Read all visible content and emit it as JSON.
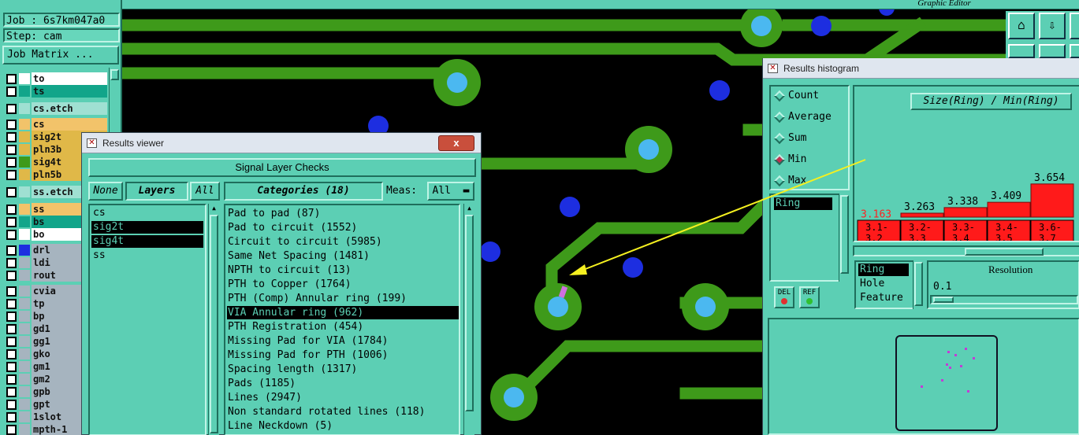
{
  "left_panel": {
    "job_line": "Job : 6s7km047a0",
    "step_line": "Step: cam",
    "job_matrix_label": "Job Matrix ...",
    "layers": [
      {
        "name": "to",
        "color": "#ffffff",
        "board": true
      },
      {
        "name": "ts",
        "color": "#12a58a",
        "board": false
      },
      {
        "name": "cs.etch",
        "color": "#9fe0d2",
        "board": false
      },
      {
        "name": "cs",
        "color": "#f2c36a",
        "board": true
      },
      {
        "name": "sig2t",
        "color": "#e0b848",
        "board": false
      },
      {
        "name": "pln3b",
        "color": "#e0b848",
        "board": false
      },
      {
        "name": "sig4t",
        "color": "#e0b848",
        "board": false
      },
      {
        "name": "pln5b",
        "color": "#e0b848",
        "board": false
      },
      {
        "name": "ss.etch",
        "color": "#9fe0d2",
        "board": false
      },
      {
        "name": "ss",
        "color": "#f2c36a",
        "board": false
      },
      {
        "name": "bs",
        "color": "#12a58a",
        "board": false
      },
      {
        "name": "bo",
        "color": "#ffffff",
        "board": false
      },
      {
        "name": "drl",
        "color": "#a6b4bf",
        "board": false
      },
      {
        "name": "ldi",
        "color": "#a6b4bf",
        "board": false
      },
      {
        "name": "rout",
        "color": "#a6b4bf",
        "board": false
      },
      {
        "name": "cvia",
        "color": "#a6b4bf",
        "board": false
      },
      {
        "name": "tp",
        "color": "#a6b4bf",
        "board": false
      },
      {
        "name": "bp",
        "color": "#a6b4bf",
        "board": false
      },
      {
        "name": "gd1",
        "color": "#a6b4bf",
        "board": false
      },
      {
        "name": "gg1",
        "color": "#a6b4bf",
        "board": false
      },
      {
        "name": "gko",
        "color": "#a6b4bf",
        "board": false
      },
      {
        "name": "gm1",
        "color": "#a6b4bf",
        "board": false
      },
      {
        "name": "gm2",
        "color": "#a6b4bf",
        "board": false
      },
      {
        "name": "gpb",
        "color": "#a6b4bf",
        "board": false
      },
      {
        "name": "gpt",
        "color": "#a6b4bf",
        "board": false
      },
      {
        "name": "1slot",
        "color": "#a6b4bf",
        "board": false
      },
      {
        "name": "mpth-1",
        "color": "#a6b4bf",
        "board": false
      }
    ]
  },
  "graphic_editor": {
    "title": "Graphic Editor"
  },
  "results_viewer": {
    "title": "Results viewer",
    "close_label": "x",
    "heading": "Signal Layer Checks",
    "none_label": "None",
    "layers_label": "Layers",
    "all_label": "All",
    "categories_label": "Categories (18)",
    "meas_label": "Meas:",
    "meas_value": "All",
    "layers": [
      {
        "name": "cs",
        "selected": false
      },
      {
        "name": "sig2t",
        "selected": true
      },
      {
        "name": "sig4t",
        "selected": true
      },
      {
        "name": "ss",
        "selected": false
      }
    ],
    "categories": [
      {
        "label": "Pad to pad (87)",
        "selected": false
      },
      {
        "label": "Pad to circuit (1552)",
        "selected": false
      },
      {
        "label": "Circuit to circuit (5985)",
        "selected": false
      },
      {
        "label": "Same Net Spacing (1481)",
        "selected": false
      },
      {
        "label": "NPTH to circuit (13)",
        "selected": false
      },
      {
        "label": "PTH to Copper (1764)",
        "selected": false
      },
      {
        "label": "PTH (Comp) Annular ring (199)",
        "selected": false
      },
      {
        "label": "VIA Annular ring (962)",
        "selected": true
      },
      {
        "label": "PTH Registration (454)",
        "selected": false
      },
      {
        "label": "Missing Pad for VIA (1784)",
        "selected": false
      },
      {
        "label": "Missing Pad for PTH (1006)",
        "selected": false
      },
      {
        "label": "Spacing length (1317)",
        "selected": false
      },
      {
        "label": "Pads (1185)",
        "selected": false
      },
      {
        "label": "Lines (2947)",
        "selected": false
      },
      {
        "label": "Non standard rotated lines (118)",
        "selected": false
      },
      {
        "label": "Line Neckdown (5)",
        "selected": false
      }
    ]
  },
  "results_histogram": {
    "title": "Results histogram",
    "modes": [
      {
        "label": "Count",
        "on": false
      },
      {
        "label": "Average",
        "on": false
      },
      {
        "label": "Sum",
        "on": false
      },
      {
        "label": "Min",
        "on": true
      },
      {
        "label": "Max",
        "on": false
      }
    ],
    "left_list_item": "Ring",
    "del_label": "DEL",
    "ref_label": "REF",
    "measure_list": [
      {
        "label": "Ring",
        "selected": true
      },
      {
        "label": "Hole",
        "selected": false
      },
      {
        "label": "Feature",
        "selected": false
      }
    ],
    "resolution_label": "Resolution",
    "resolution_value": "0.1",
    "bar_color": "#ff1a1a",
    "highlight_color": "#ff2020"
  },
  "chart_data": {
    "type": "bar",
    "title": "Size(Ring) / Min(Ring)",
    "categories": [
      "3.1-\n3.2",
      "3.2-\n3.3",
      "3.3-\n3.4",
      "3.4-\n3.5",
      "3.6-\n3.7"
    ],
    "values": [
      3.163,
      3.263,
      3.338,
      3.409,
      3.654
    ],
    "value_labels": [
      "3.163",
      "3.263",
      "3.338",
      "3.409",
      "3.654"
    ],
    "highlight_index": 0
  }
}
